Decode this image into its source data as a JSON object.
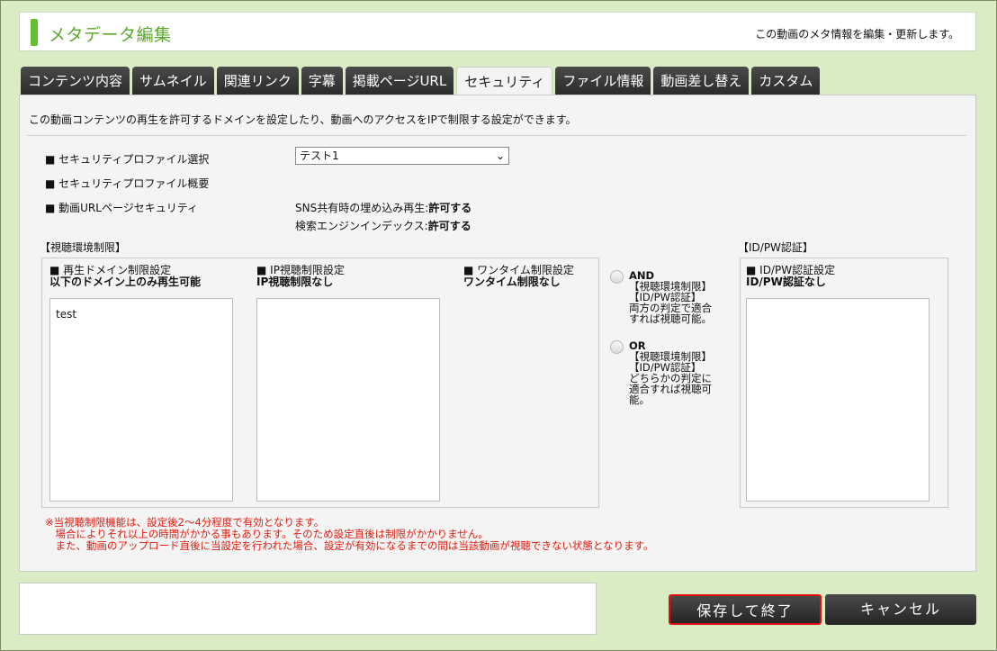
{
  "header": {
    "title": "メタデータ編集",
    "description": "この動画のメタ情報を編集・更新します。"
  },
  "tabs": [
    {
      "label": "コンテンツ内容"
    },
    {
      "label": "サムネイル"
    },
    {
      "label": "関連リンク"
    },
    {
      "label": "字幕"
    },
    {
      "label": "掲載ページURL"
    },
    {
      "label": "セキュリティ",
      "active": true
    },
    {
      "label": "ファイル情報"
    },
    {
      "label": "動画差し替え"
    },
    {
      "label": "カスタム"
    }
  ],
  "security": {
    "intro": "この動画コンテンツの再生を許可するドメインを設定したり、動画へのアクセスをIPで制限する設定ができます。",
    "profile_select_label": "■ セキュリティプロファイル選択",
    "profile_select_value": "テスト1",
    "profile_summary_label": "■ セキュリティプロファイル概要",
    "url_security_label": "■ 動画URLページセキュリティ",
    "sns_embed_label": "SNS共有時の埋め込み再生:",
    "sns_embed_value": "許可する",
    "search_index_label": "検索エンジンインデックス:",
    "search_index_value": "許可する"
  },
  "viewing_env": {
    "group_label": "【視聴環境制限】",
    "domain": {
      "title": "■ 再生ドメイン制限設定",
      "sub": "以下のドメイン上のみ再生可能",
      "items": [
        "test"
      ]
    },
    "ip": {
      "title": "■ IP視聴制限設定",
      "sub": "IP視聴制限なし"
    },
    "onetime": {
      "title": "■ ワンタイム制限設定",
      "sub": "ワンタイム制限なし"
    }
  },
  "logic": {
    "and_head": "AND",
    "and_lines": [
      "【視聴環境制限】",
      "【ID/PW認証】",
      "両方の判定で適合",
      "すれば視聴可能。"
    ],
    "or_head": "OR",
    "or_lines": [
      "【視聴環境制限】",
      "【ID/PW認証】",
      "どちらかの判定に",
      "適合すれば視聴可",
      "能。"
    ]
  },
  "idpw": {
    "group_label": "【ID/PW認証】",
    "title": "■ ID/PW認証設定",
    "sub": "ID/PW認証なし"
  },
  "warning": [
    "※当視聴制限機能は、設定後2～4分程度で有効となります。",
    "　場合によりそれ以上の時間がかかる事もあります。そのため設定直後は制限がかかりません。",
    "　また、動画のアップロード直後に当設定を行われた場合、設定が有効になるまでの間は当該動画が視聴できない状態となります。"
  ],
  "buttons": {
    "save": "保存して終了",
    "cancel": "キャンセル"
  },
  "colors": {
    "background": "#d9ecc4",
    "accent_green": "#5fbf2c",
    "tab_dark": "#333333",
    "warning_red": "#e31b0c",
    "save_outline": "#e01010"
  }
}
